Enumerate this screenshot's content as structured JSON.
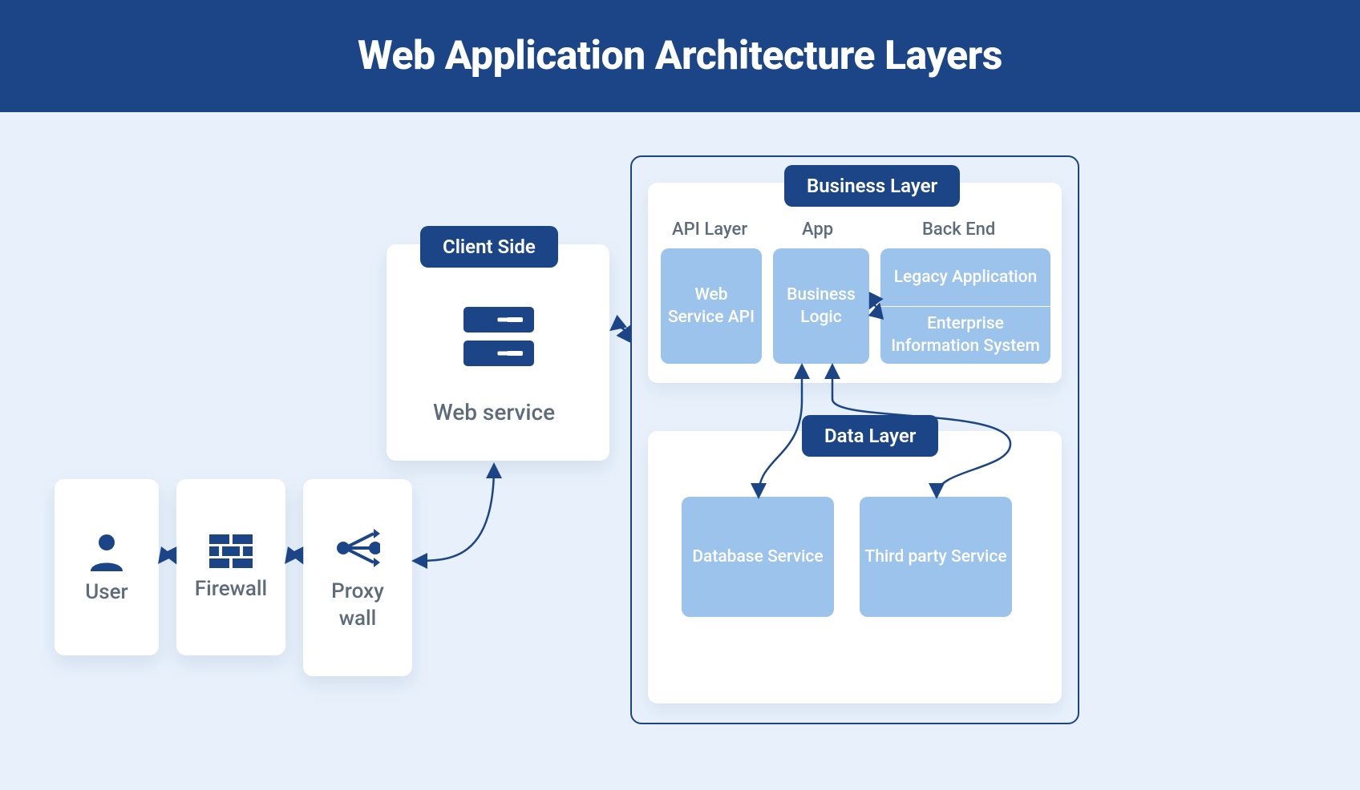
{
  "title": "Web Application Architecture Layers",
  "nodes": {
    "user": "User",
    "firewall": "Firewall",
    "proxy": "Proxy wall",
    "client_side_badge": "Client Side",
    "web_service": "Web service"
  },
  "business_layer": {
    "badge": "Business Layer",
    "columns": {
      "api": "API Layer",
      "app": "App",
      "back": "Back End"
    },
    "boxes": {
      "api": "Web Service API",
      "logic": "Business Logic",
      "legacy": "Legacy Application",
      "eis": "Enterprise Information System"
    }
  },
  "data_layer": {
    "badge": "Data Layer",
    "boxes": {
      "db": "Database Service",
      "third_party": "Third party Service"
    }
  },
  "colors": {
    "header_bg": "#1c4587",
    "page_bg": "#e8f1fb",
    "box_blue": "#9cc3eb",
    "text_muted": "#5d6b7a"
  }
}
